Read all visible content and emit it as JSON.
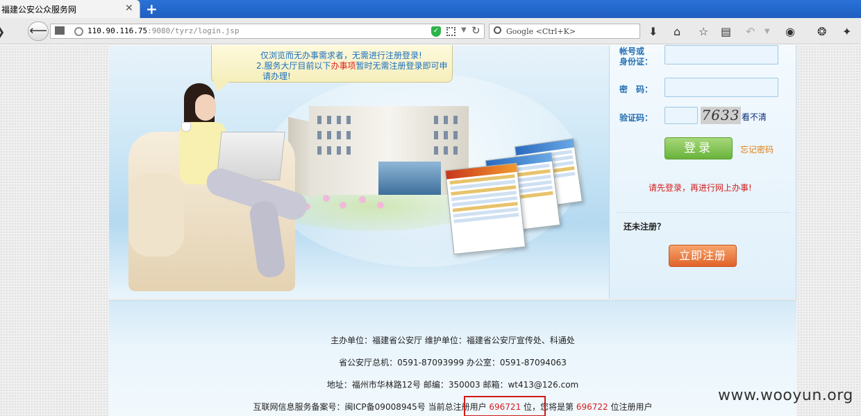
{
  "browser": {
    "tab_title": "福建公安公众服务网",
    "tab_close": "✕",
    "new_tab": "+",
    "url_host": "110.90.116.75",
    "url_rest": ":9080/tyrz/login.jsp",
    "search_placeholder": "Google <Ctrl+K>"
  },
  "notice": {
    "line1": "仅浏览而无办事需求者，无需进行注册登录!",
    "line2_pre": "2.服务大厅目前以下",
    "line2_hl": "办事项",
    "line2_post": "暂时无需注册登录即可申",
    "line3": "请办理!"
  },
  "login": {
    "account_label_1": "帐号或",
    "account_label_2": "身份证：",
    "password_label": "密　码：",
    "captcha_label": "验证码：",
    "captcha_text": "7633",
    "unclear_link": "看不清",
    "login_button": "登录",
    "forgot_link": "忘记密码",
    "login_tip": "请先登录，再进行网上办事!",
    "unregistered_title": "还未注册？",
    "register_button": "立即注册"
  },
  "footer": {
    "line1": "主办单位：福建省公安厅 维护单位：福建省公安厅宣传处、科通处",
    "line2": "省公安厅总机：0591-87093999 办公室：0591-87094063",
    "line3": "地址：福州市华林路12号 邮编：350003 邮箱：wt413@126.com",
    "line4_pre": "互联网信息服务备案号：闽ICP备09008945号 当前总注册用户 ",
    "registered_count": "696721",
    "line4_mid": " 位，您将是第 ",
    "next_number": "696722",
    "line4_post": " 位注册用户"
  },
  "watermark": "www.wooyun.org"
}
